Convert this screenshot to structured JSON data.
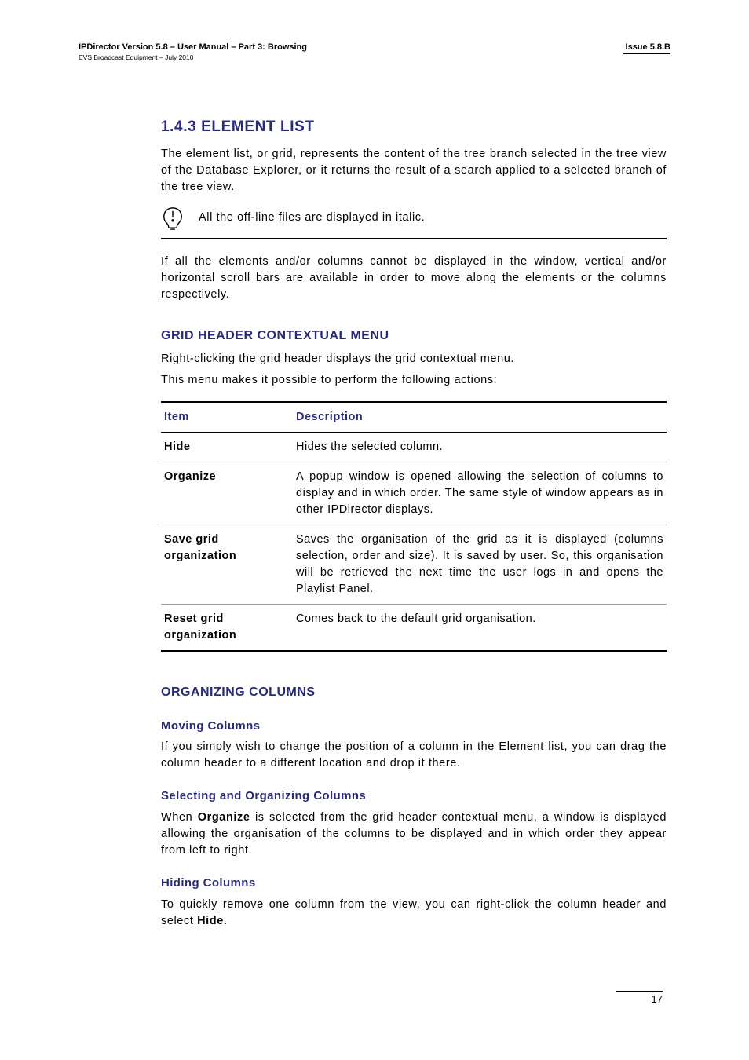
{
  "header": {
    "left_line1": "IPDirector Version 5.8 – User Manual – Part 3: Browsing",
    "left_line2": "EVS Broadcast Equipment – July 2010",
    "issue": "Issue 5.8.B"
  },
  "sections": {
    "element_list": {
      "heading": "1.4.3 ELEMENT LIST",
      "p1": "The element list, or grid, represents the content of the tree branch selected in the tree view of the Database Explorer, or it returns the result of a search applied to a selected branch of the tree view.",
      "note": "All the off-line files are displayed in italic.",
      "p2": "If all the elements and/or columns cannot be displayed in the window, vertical and/or horizontal scroll bars are available in order to move along the elements or the columns respectively."
    },
    "grid_header_menu": {
      "heading": "GRID HEADER CONTEXTUAL MENU",
      "p1": "Right-clicking the grid header displays the grid contextual menu.",
      "p2": "This menu makes it possible to perform the following actions:",
      "table": {
        "head_col1": "Item",
        "head_col2": "Description",
        "rows": [
          {
            "key": "Hide",
            "desc": "Hides the selected column."
          },
          {
            "key": "Organize",
            "desc": "A popup window is opened allowing the selection of columns to display and in which order. The same style of window appears as in other IPDirector displays."
          },
          {
            "key": "Save grid organization",
            "desc": "Saves the organisation of the grid as it is displayed (columns selection, order and size). It is saved by user. So, this organisation will be retrieved the next time the user logs in and opens the Playlist Panel."
          },
          {
            "key": "Reset grid organization",
            "desc": "Comes back to the default grid organisation."
          }
        ]
      }
    },
    "organizing": {
      "heading": "ORGANIZING COLUMNS",
      "sub1": {
        "heading": "Moving Columns",
        "text": "If you simply wish to change the position of a column in the Element list, you can drag the column header to a different location and drop it there."
      },
      "sub2": {
        "heading": "Selecting and Organizing Columns",
        "pre": "When ",
        "bold": "Organize",
        "post": " is selected from the grid header contextual menu, a window is displayed allowing the organisation of the columns to be displayed and in which order they appear from left to right."
      },
      "sub3": {
        "heading": "Hiding Columns",
        "pre": "To quickly remove one column from the view, you can right-click the column header and select ",
        "bold": "Hide",
        "post": "."
      }
    }
  },
  "footer": {
    "page": "17"
  }
}
